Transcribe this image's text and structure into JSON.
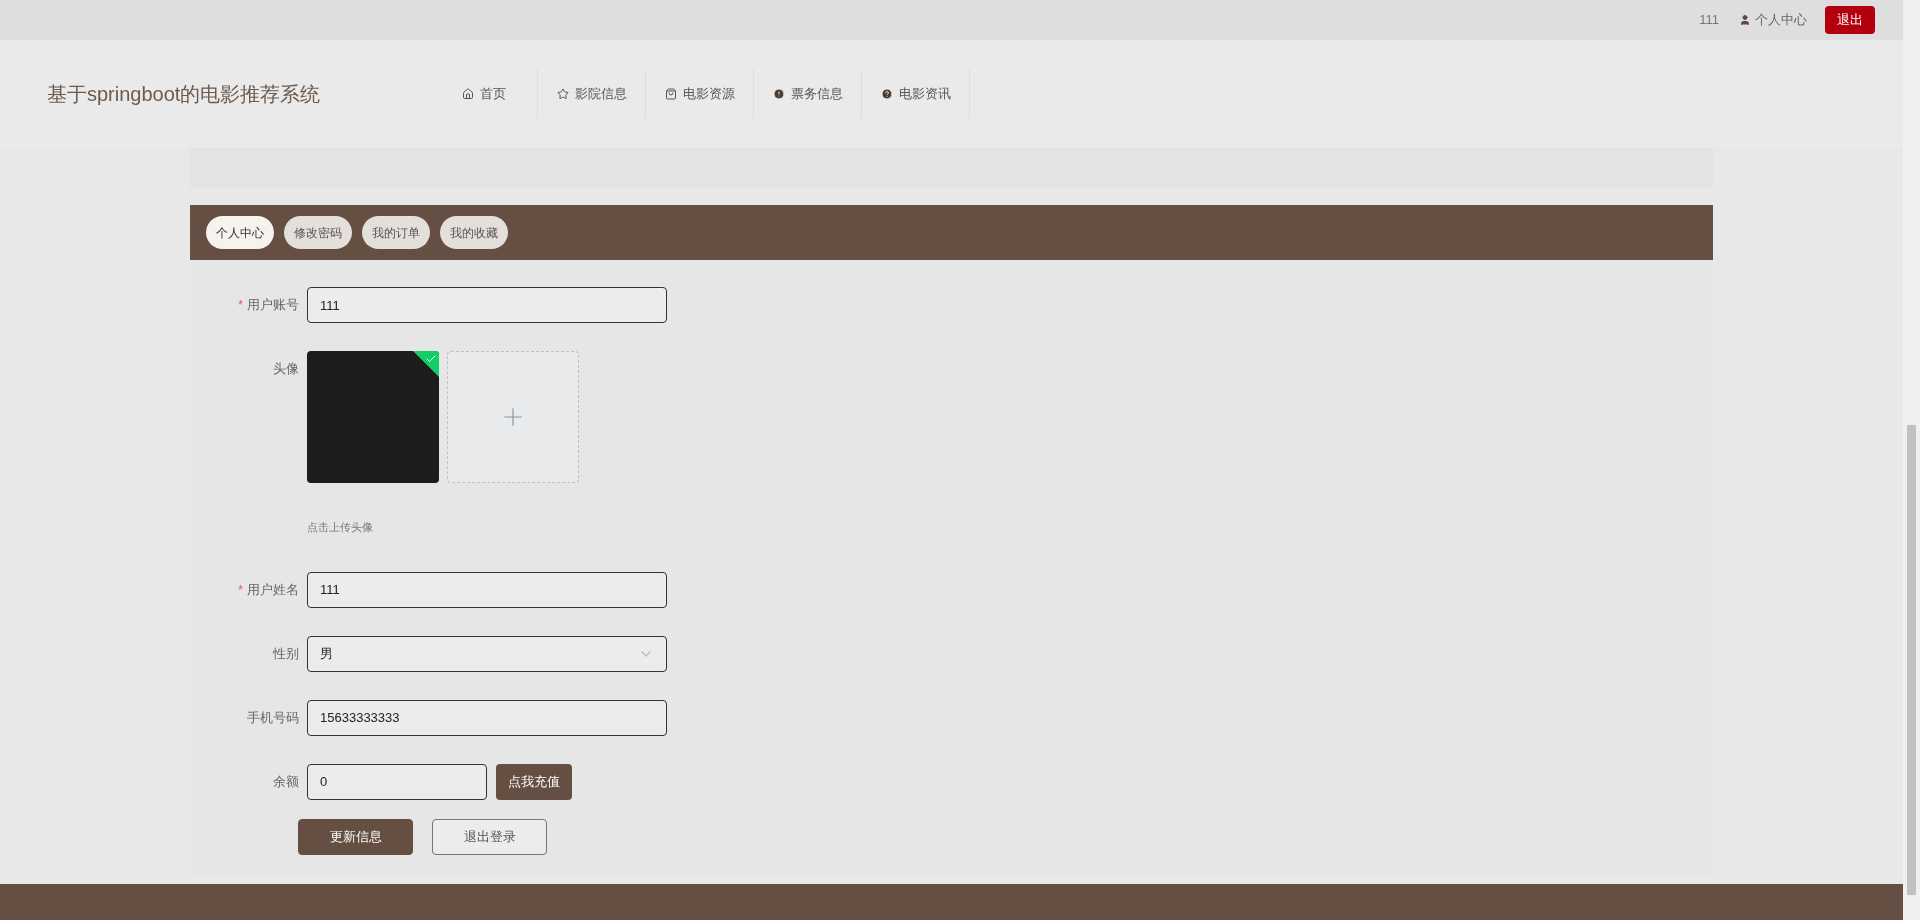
{
  "top_bar": {
    "username": "111",
    "user_center": "个人中心",
    "logout": "退出"
  },
  "header": {
    "title": "基于springboot的电影推荐系统",
    "nav": [
      {
        "label": "首页",
        "kind": "home"
      },
      {
        "label": "影院信息",
        "kind": "star"
      },
      {
        "label": "电影资源",
        "kind": "bag"
      },
      {
        "label": "票务信息",
        "kind": "alert"
      },
      {
        "label": "电影资讯",
        "kind": "help"
      }
    ]
  },
  "tabs": [
    {
      "label": "个人中心",
      "selected": true
    },
    {
      "label": "修改密码",
      "selected": false
    },
    {
      "label": "我的订单",
      "selected": false
    },
    {
      "label": "我的收藏",
      "selected": false
    }
  ],
  "form": {
    "fields": [
      {
        "kind": "text",
        "label": "用户账号",
        "required_mark": "*",
        "value": "111"
      },
      {
        "kind": "avatar",
        "label": "头像",
        "uploaded": true,
        "hint": "点击上传头像"
      },
      {
        "kind": "text",
        "label": "用户姓名",
        "required_mark": "*",
        "value": "111"
      },
      {
        "kind": "select",
        "label": "性别",
        "value": "男"
      },
      {
        "kind": "text",
        "label": "手机号码",
        "value": "15633333333"
      },
      {
        "kind": "balance",
        "label": "余额",
        "value": "0",
        "action": "点我充值"
      }
    ],
    "buttons": [
      {
        "label": "更新信息",
        "kind": "primary"
      },
      {
        "label": "退出登录",
        "kind": "outline"
      }
    ]
  }
}
